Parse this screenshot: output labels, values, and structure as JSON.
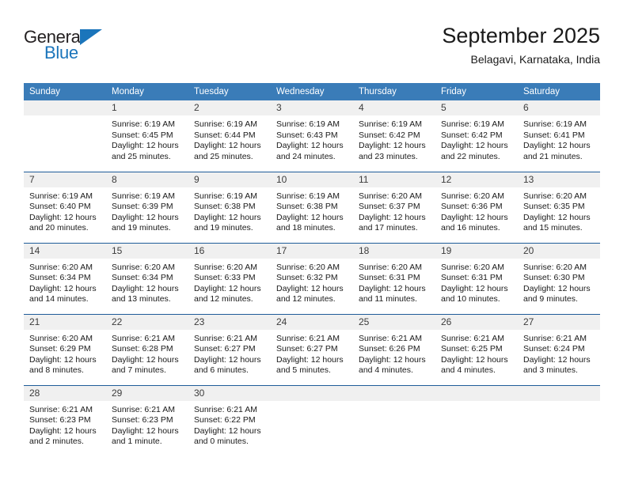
{
  "logo": {
    "line1": "General",
    "line2": "Blue",
    "triangle_icon": "triangle-icon",
    "brand_color": "#1b75bb",
    "text_color": "#231f20"
  },
  "header": {
    "title": "September 2025",
    "subtitle": "Belagavi, Karnataka, India"
  },
  "theme": {
    "header_bg": "#3a7cb8",
    "header_text": "#ffffff",
    "daynum_bg": "#f0f0f0",
    "grid_line": "#1f5c99",
    "body_text": "#1a1a1a"
  },
  "weekday_headers": [
    "Sunday",
    "Monday",
    "Tuesday",
    "Wednesday",
    "Thursday",
    "Friday",
    "Saturday"
  ],
  "weeks": [
    [
      {
        "day": "",
        "sunrise": "",
        "sunset": "",
        "daylight_line1": "",
        "daylight_line2": ""
      },
      {
        "day": "1",
        "sunrise": "Sunrise: 6:19 AM",
        "sunset": "Sunset: 6:45 PM",
        "daylight_line1": "Daylight: 12 hours",
        "daylight_line2": "and 25 minutes."
      },
      {
        "day": "2",
        "sunrise": "Sunrise: 6:19 AM",
        "sunset": "Sunset: 6:44 PM",
        "daylight_line1": "Daylight: 12 hours",
        "daylight_line2": "and 25 minutes."
      },
      {
        "day": "3",
        "sunrise": "Sunrise: 6:19 AM",
        "sunset": "Sunset: 6:43 PM",
        "daylight_line1": "Daylight: 12 hours",
        "daylight_line2": "and 24 minutes."
      },
      {
        "day": "4",
        "sunrise": "Sunrise: 6:19 AM",
        "sunset": "Sunset: 6:42 PM",
        "daylight_line1": "Daylight: 12 hours",
        "daylight_line2": "and 23 minutes."
      },
      {
        "day": "5",
        "sunrise": "Sunrise: 6:19 AM",
        "sunset": "Sunset: 6:42 PM",
        "daylight_line1": "Daylight: 12 hours",
        "daylight_line2": "and 22 minutes."
      },
      {
        "day": "6",
        "sunrise": "Sunrise: 6:19 AM",
        "sunset": "Sunset: 6:41 PM",
        "daylight_line1": "Daylight: 12 hours",
        "daylight_line2": "and 21 minutes."
      }
    ],
    [
      {
        "day": "7",
        "sunrise": "Sunrise: 6:19 AM",
        "sunset": "Sunset: 6:40 PM",
        "daylight_line1": "Daylight: 12 hours",
        "daylight_line2": "and 20 minutes."
      },
      {
        "day": "8",
        "sunrise": "Sunrise: 6:19 AM",
        "sunset": "Sunset: 6:39 PM",
        "daylight_line1": "Daylight: 12 hours",
        "daylight_line2": "and 19 minutes."
      },
      {
        "day": "9",
        "sunrise": "Sunrise: 6:19 AM",
        "sunset": "Sunset: 6:38 PM",
        "daylight_line1": "Daylight: 12 hours",
        "daylight_line2": "and 19 minutes."
      },
      {
        "day": "10",
        "sunrise": "Sunrise: 6:19 AM",
        "sunset": "Sunset: 6:38 PM",
        "daylight_line1": "Daylight: 12 hours",
        "daylight_line2": "and 18 minutes."
      },
      {
        "day": "11",
        "sunrise": "Sunrise: 6:20 AM",
        "sunset": "Sunset: 6:37 PM",
        "daylight_line1": "Daylight: 12 hours",
        "daylight_line2": "and 17 minutes."
      },
      {
        "day": "12",
        "sunrise": "Sunrise: 6:20 AM",
        "sunset": "Sunset: 6:36 PM",
        "daylight_line1": "Daylight: 12 hours",
        "daylight_line2": "and 16 minutes."
      },
      {
        "day": "13",
        "sunrise": "Sunrise: 6:20 AM",
        "sunset": "Sunset: 6:35 PM",
        "daylight_line1": "Daylight: 12 hours",
        "daylight_line2": "and 15 minutes."
      }
    ],
    [
      {
        "day": "14",
        "sunrise": "Sunrise: 6:20 AM",
        "sunset": "Sunset: 6:34 PM",
        "daylight_line1": "Daylight: 12 hours",
        "daylight_line2": "and 14 minutes."
      },
      {
        "day": "15",
        "sunrise": "Sunrise: 6:20 AM",
        "sunset": "Sunset: 6:34 PM",
        "daylight_line1": "Daylight: 12 hours",
        "daylight_line2": "and 13 minutes."
      },
      {
        "day": "16",
        "sunrise": "Sunrise: 6:20 AM",
        "sunset": "Sunset: 6:33 PM",
        "daylight_line1": "Daylight: 12 hours",
        "daylight_line2": "and 12 minutes."
      },
      {
        "day": "17",
        "sunrise": "Sunrise: 6:20 AM",
        "sunset": "Sunset: 6:32 PM",
        "daylight_line1": "Daylight: 12 hours",
        "daylight_line2": "and 12 minutes."
      },
      {
        "day": "18",
        "sunrise": "Sunrise: 6:20 AM",
        "sunset": "Sunset: 6:31 PM",
        "daylight_line1": "Daylight: 12 hours",
        "daylight_line2": "and 11 minutes."
      },
      {
        "day": "19",
        "sunrise": "Sunrise: 6:20 AM",
        "sunset": "Sunset: 6:31 PM",
        "daylight_line1": "Daylight: 12 hours",
        "daylight_line2": "and 10 minutes."
      },
      {
        "day": "20",
        "sunrise": "Sunrise: 6:20 AM",
        "sunset": "Sunset: 6:30 PM",
        "daylight_line1": "Daylight: 12 hours",
        "daylight_line2": "and 9 minutes."
      }
    ],
    [
      {
        "day": "21",
        "sunrise": "Sunrise: 6:20 AM",
        "sunset": "Sunset: 6:29 PM",
        "daylight_line1": "Daylight: 12 hours",
        "daylight_line2": "and 8 minutes."
      },
      {
        "day": "22",
        "sunrise": "Sunrise: 6:21 AM",
        "sunset": "Sunset: 6:28 PM",
        "daylight_line1": "Daylight: 12 hours",
        "daylight_line2": "and 7 minutes."
      },
      {
        "day": "23",
        "sunrise": "Sunrise: 6:21 AM",
        "sunset": "Sunset: 6:27 PM",
        "daylight_line1": "Daylight: 12 hours",
        "daylight_line2": "and 6 minutes."
      },
      {
        "day": "24",
        "sunrise": "Sunrise: 6:21 AM",
        "sunset": "Sunset: 6:27 PM",
        "daylight_line1": "Daylight: 12 hours",
        "daylight_line2": "and 5 minutes."
      },
      {
        "day": "25",
        "sunrise": "Sunrise: 6:21 AM",
        "sunset": "Sunset: 6:26 PM",
        "daylight_line1": "Daylight: 12 hours",
        "daylight_line2": "and 4 minutes."
      },
      {
        "day": "26",
        "sunrise": "Sunrise: 6:21 AM",
        "sunset": "Sunset: 6:25 PM",
        "daylight_line1": "Daylight: 12 hours",
        "daylight_line2": "and 4 minutes."
      },
      {
        "day": "27",
        "sunrise": "Sunrise: 6:21 AM",
        "sunset": "Sunset: 6:24 PM",
        "daylight_line1": "Daylight: 12 hours",
        "daylight_line2": "and 3 minutes."
      }
    ],
    [
      {
        "day": "28",
        "sunrise": "Sunrise: 6:21 AM",
        "sunset": "Sunset: 6:23 PM",
        "daylight_line1": "Daylight: 12 hours",
        "daylight_line2": "and 2 minutes."
      },
      {
        "day": "29",
        "sunrise": "Sunrise: 6:21 AM",
        "sunset": "Sunset: 6:23 PM",
        "daylight_line1": "Daylight: 12 hours",
        "daylight_line2": "and 1 minute."
      },
      {
        "day": "30",
        "sunrise": "Sunrise: 6:21 AM",
        "sunset": "Sunset: 6:22 PM",
        "daylight_line1": "Daylight: 12 hours",
        "daylight_line2": "and 0 minutes."
      },
      {
        "day": "",
        "sunrise": "",
        "sunset": "",
        "daylight_line1": "",
        "daylight_line2": ""
      },
      {
        "day": "",
        "sunrise": "",
        "sunset": "",
        "daylight_line1": "",
        "daylight_line2": ""
      },
      {
        "day": "",
        "sunrise": "",
        "sunset": "",
        "daylight_line1": "",
        "daylight_line2": ""
      },
      {
        "day": "",
        "sunrise": "",
        "sunset": "",
        "daylight_line1": "",
        "daylight_line2": ""
      }
    ]
  ]
}
